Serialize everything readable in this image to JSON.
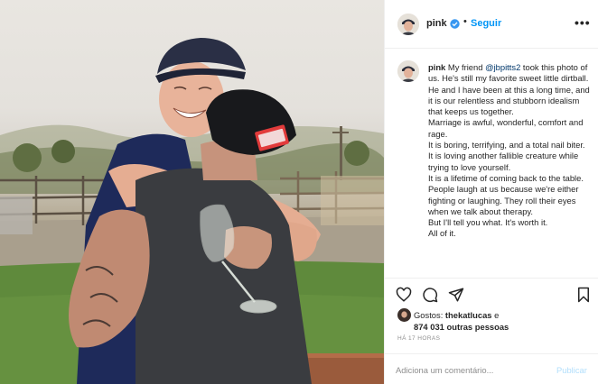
{
  "post": {
    "username": "pink",
    "follow_label": "Seguir",
    "dot": "•",
    "more_label": "•••",
    "accent_color": "#0095f6",
    "caption": {
      "username": "pink",
      "intro": "My friend ",
      "mention": "@jbpitts2",
      "lines": [
        " took this photo of us. He's still my favorite sweet little dirtball. He and I have been at this a long time, and it is our relentless and stubborn idealism that keeps us together.",
        "Marriage is awful, wonderful, comfort and rage.",
        "It is boring, terrifying, and a total nail biter.",
        "It is loving another fallible creature while trying to love yourself.",
        "It is a lifetime of coming back to the table. People laugh at us because we're either fighting or laughing. They roll their eyes when we talk about therapy.",
        "But I'll tell you what. It's worth it.",
        "All of it."
      ]
    },
    "actions": {
      "like_icon": "heart-icon",
      "comment_icon": "comment-icon",
      "share_icon": "share-icon",
      "save_icon": "bookmark-icon"
    },
    "likes": {
      "prefix": "Gostos: ",
      "user": "thekatlucas",
      "connector": " e",
      "others": "874 031 outras pessoas"
    },
    "time": "HÁ 17 HORAS",
    "comment": {
      "placeholder": "Adiciona um comentário...",
      "publish_label": "Publicar"
    }
  }
}
